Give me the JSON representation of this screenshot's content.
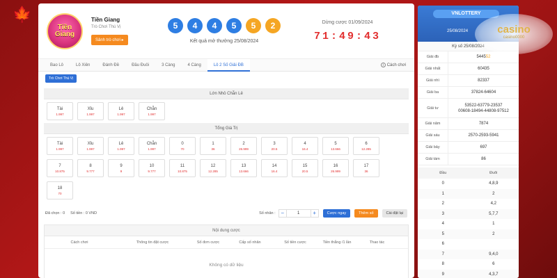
{
  "game": {
    "name": "Tiền Giang",
    "logo_text": "Tiền Giang",
    "subtitle": "Trò Chơi Thú Vị",
    "lobby_button": "Sảnh trò chơi ▸"
  },
  "results": {
    "balls": [
      {
        "n": "5",
        "color": "blue"
      },
      {
        "n": "4",
        "color": "blue"
      },
      {
        "n": "4",
        "color": "blue"
      },
      {
        "n": "5",
        "color": "blue"
      },
      {
        "n": "5",
        "color": "orange"
      },
      {
        "n": "2",
        "color": "orange"
      }
    ],
    "caption": "Kết quả mở thưởng 25/08/2024"
  },
  "countdown": {
    "deadline_label": "Dừng cược 01/09/2024",
    "time": "71:49:43"
  },
  "tabs": [
    "Bao Lô",
    "Lô Xiên",
    "Đánh Đề",
    "Đầu Đuôi",
    "3 Càng",
    "4 Càng",
    "Lô 2 Số Giải ĐB"
  ],
  "active_tab": 6,
  "howto_label": "Cách chơi",
  "sub_button": "Trò Chơi Thú Vị",
  "section1": {
    "title": "Lớn Nhỏ Chẵn Lẻ",
    "chips": [
      {
        "label": "Tài",
        "odds": "1.997"
      },
      {
        "label": "Xỉu",
        "odds": "1.997"
      },
      {
        "label": "Lẻ",
        "odds": "1.997"
      },
      {
        "label": "Chẵn",
        "odds": "1.997"
      }
    ]
  },
  "section2": {
    "title": "Tổng Giá Trị",
    "chips": [
      {
        "label": "Tài",
        "odds": "1.997"
      },
      {
        "label": "Xỉu",
        "odds": "1.997"
      },
      {
        "label": "Lẻ",
        "odds": "1.997"
      },
      {
        "label": "Chẵn",
        "odds": "1.997"
      },
      {
        "label": "0",
        "odds": "70"
      },
      {
        "label": "1",
        "odds": "36"
      },
      {
        "label": "2",
        "odds": "26.999"
      },
      {
        "label": "3",
        "odds": "20.5"
      },
      {
        "label": "4",
        "odds": "16.4"
      },
      {
        "label": "5",
        "odds": "13.666"
      },
      {
        "label": "6",
        "odds": "12.285"
      },
      {
        "label": "7",
        "odds": "10.875"
      },
      {
        "label": "8",
        "odds": "9.777"
      },
      {
        "label": "9",
        "odds": "9"
      },
      {
        "label": "10",
        "odds": "9.777"
      },
      {
        "label": "11",
        "odds": "10.875"
      },
      {
        "label": "12",
        "odds": "12.285"
      },
      {
        "label": "13",
        "odds": "13.666"
      },
      {
        "label": "14",
        "odds": "16.4"
      },
      {
        "label": "15",
        "odds": "20.5"
      },
      {
        "label": "16",
        "odds": "26.999"
      },
      {
        "label": "17",
        "odds": "36"
      },
      {
        "label": "18",
        "odds": "70"
      }
    ]
  },
  "controls": {
    "selected_label": "Đã chọn : 0",
    "amount_label": "Số tiền : 0 VND",
    "multiplier_label": "Số nhân :",
    "minus": "−",
    "multiplier_value": "1",
    "plus": "+",
    "bet_now": "Cược ngay",
    "add_bet": "Thêm số",
    "reset": "Cài đặt lại"
  },
  "content": {
    "title": "Nội dung cược",
    "columns": [
      "Cách chơi",
      "Thông tin đặt cược",
      "Số đơn cược",
      "Cấp số nhân",
      "Số tiền cược",
      "Tiền thắng /1 lần",
      "Thao tác"
    ],
    "empty": "Không có dữ liệu"
  },
  "side": {
    "brand": "VNLOTTERY",
    "date": "25/08/2024",
    "ky": "Kỳ số 25/08/2024",
    "prizes": [
      {
        "label": "Giải đb",
        "value_main": "5445",
        "value_hl": "52"
      },
      {
        "label": "Giải nhất",
        "value_main": "60435",
        "value_hl": ""
      },
      {
        "label": "Giải nhì",
        "value_main": "82337",
        "value_hl": ""
      },
      {
        "label": "Giải ba",
        "value_main": "37824-64604",
        "value_hl": ""
      },
      {
        "label": "Giải tư",
        "value_main": "53522-63779-23537\n00608-18494-44808-97512",
        "value_hl": ""
      },
      {
        "label": "Giải năm",
        "value_main": "7874",
        "value_hl": ""
      },
      {
        "label": "Giải sáu",
        "value_main": "2570-2593-5941",
        "value_hl": ""
      },
      {
        "label": "Giải bảy",
        "value_main": "697",
        "value_hl": ""
      },
      {
        "label": "Giải tám",
        "value_main": "86",
        "value_hl": ""
      }
    ],
    "dd_head": [
      "Đầu",
      "Đuôi"
    ],
    "dd_rows": [
      [
        "0",
        "4,8,9"
      ],
      [
        "1",
        "2"
      ],
      [
        "2",
        "4,2"
      ],
      [
        "3",
        "5,7,7"
      ],
      [
        "4",
        "1"
      ],
      [
        "5",
        "2"
      ],
      [
        "6",
        ""
      ],
      [
        "7",
        "9,4,0"
      ],
      [
        "8",
        "6"
      ],
      [
        "9",
        "4,3,7"
      ]
    ]
  },
  "watermark": {
    "brand": "casino",
    "site": "casino0000"
  }
}
